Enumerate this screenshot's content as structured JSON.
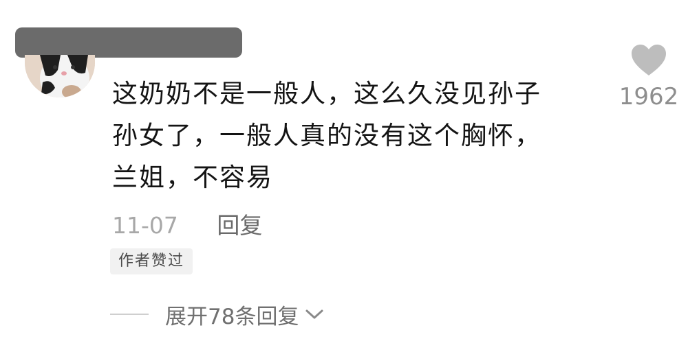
{
  "comment": {
    "lines": [
      "这奶奶不是一般人，这么久没见孙子",
      "孙女了，一般人真的没有这个胸怀，",
      "兰姐，不容易"
    ],
    "date": "11-07",
    "reply_label": "回复",
    "author_liked_badge": "作者赞过",
    "like_count": "1962",
    "expand_replies_label": "展开78条回复"
  },
  "icons": {
    "like": "heart-icon",
    "expand": "chevron-down-icon"
  },
  "colors": {
    "text_primary": "#141414",
    "text_secondary": "#9b9b9b",
    "heart_gray": "#bdbdbd",
    "badge_bg": "#f1f1f1",
    "redacted": "#6b6b6b"
  }
}
